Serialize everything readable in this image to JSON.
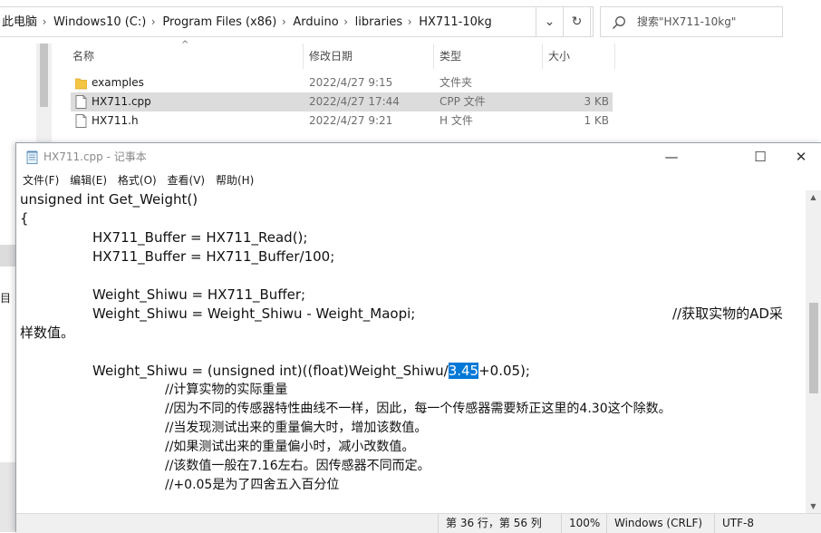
{
  "explorer": {
    "breadcrumb": [
      "此电脑",
      "Windows10 (C:)",
      "Program Files (x86)",
      "Arduino",
      "libraries",
      "HX711-10kg"
    ],
    "search_placeholder": "搜索\"HX711-10kg\"",
    "left_pane_text": "目",
    "columns": {
      "name": "名称",
      "date": "修改日期",
      "type": "类型",
      "size": "大小"
    },
    "files": [
      {
        "name": "examples",
        "date": "2022/4/27 9:15",
        "type": "文件夹",
        "size": "",
        "icon": "folder-icon"
      },
      {
        "name": "HX711.cpp",
        "date": "2022/4/27 17:44",
        "type": "CPP 文件",
        "size": "3 KB",
        "icon": "file-icon"
      },
      {
        "name": "HX711.h",
        "date": "2022/4/27 9:21",
        "type": "H 文件",
        "size": "1 KB",
        "icon": "file-icon"
      }
    ]
  },
  "notepad": {
    "title": "HX711.cpp - 记事本",
    "menu": [
      "文件(F)",
      "编辑(E)",
      "格式(O)",
      "查看(V)",
      "帮助(H)"
    ],
    "code": {
      "l1": "unsigned int Get_Weight()",
      "l2": "{",
      "l3": "HX711_Buffer = HX711_Read();",
      "l4": "HX711_Buffer = HX711_Buffer/100;",
      "l5": "Weight_Shiwu = HX711_Buffer;",
      "l6": "Weight_Shiwu = Weight_Shiwu - Weight_Maopi;",
      "l6_comment": "//获取实物的AD采",
      "l6_wrap": "样数值。",
      "l7_pre": "Weight_Shiwu = (unsigned int)((float)Weight_Shiwu/",
      "l7_sel": "3.45",
      "l7_post": "+0.05);",
      "c1": "//计算实物的实际重量",
      "c2": "//因为不同的传感器特性曲线不一样，因此，每一个传感器需要矫正这里的4.30这个除数。",
      "c3": "//当发现测试出来的重量偏大时，增加该数值。",
      "c4": "//如果测试出来的重量偏小时，减小改数值。",
      "c5": "//该数值一般在7.16左右。因传感器不同而定。",
      "c6": "//+0.05是为了四舍五入百分位"
    },
    "status": {
      "position": "第 36 行，第 56 列",
      "zoom": "100%",
      "line_ending": "Windows (CRLF)",
      "encoding": "UTF-8"
    }
  }
}
